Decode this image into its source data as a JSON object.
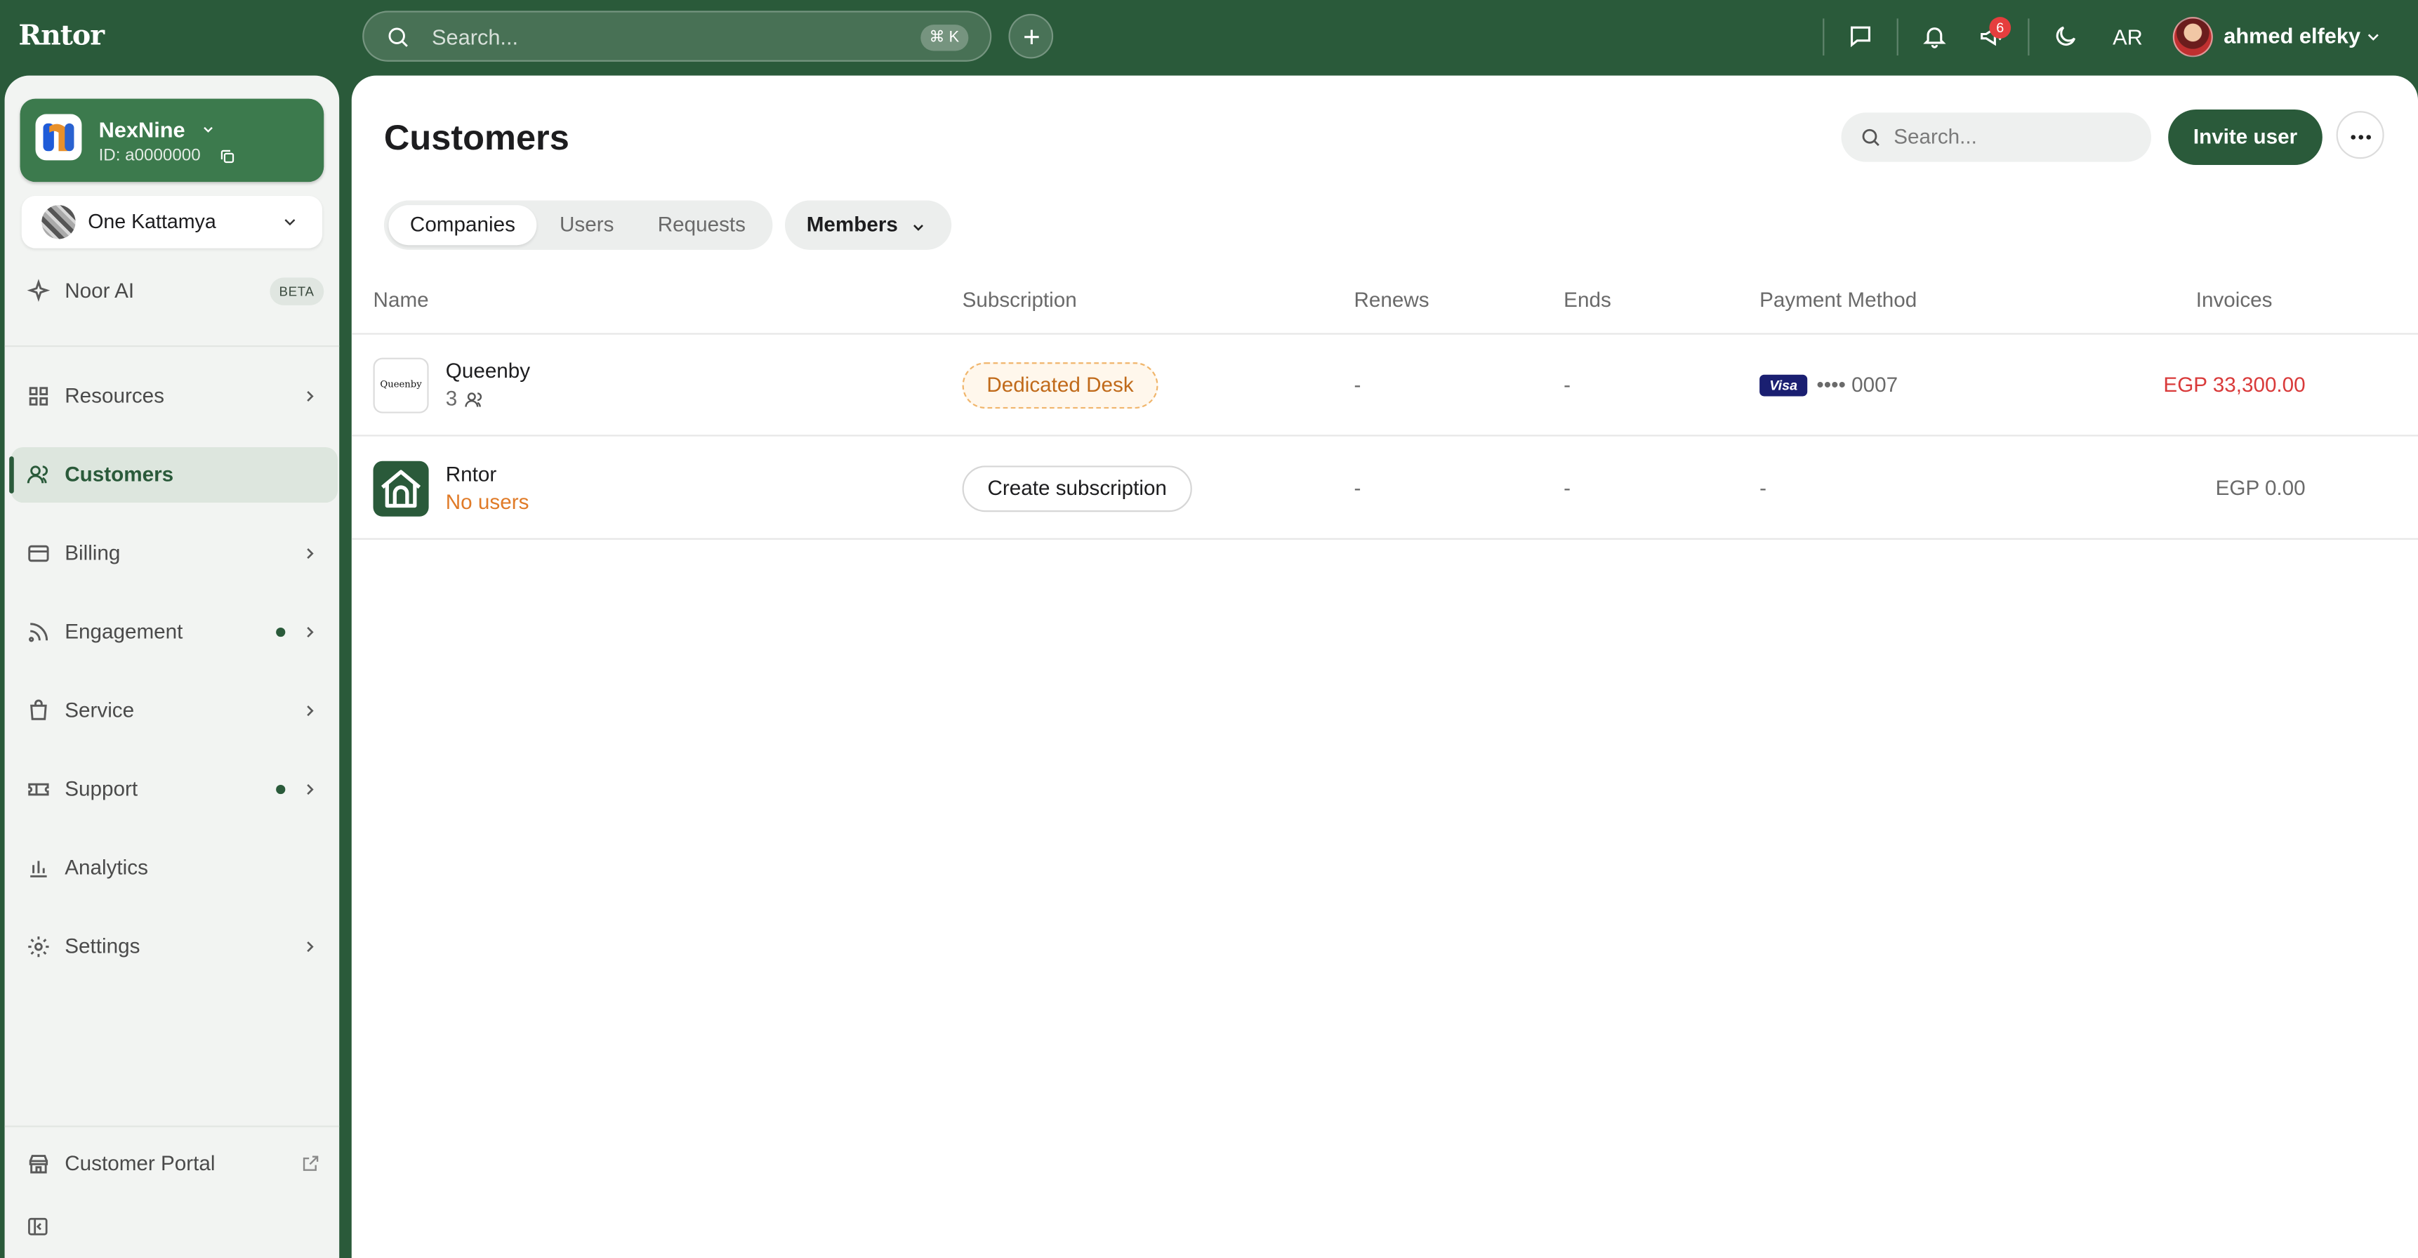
{
  "app": {
    "logo": "Rntor"
  },
  "topbar": {
    "search_placeholder": "Search...",
    "search_shortcut": "⌘ K",
    "notification_count": "6",
    "language": "AR",
    "user_name": "ahmed elfeky"
  },
  "sidebar": {
    "org": {
      "name": "NexNine",
      "id": "ID: a0000000"
    },
    "location": {
      "name": "One Kattamya"
    },
    "ai": {
      "label": "Noor AI",
      "badge": "BETA"
    },
    "items": [
      {
        "label": "Resources"
      },
      {
        "label": "Customers"
      },
      {
        "label": "Billing"
      },
      {
        "label": "Engagement"
      },
      {
        "label": "Service"
      },
      {
        "label": "Support"
      },
      {
        "label": "Analytics"
      },
      {
        "label": "Settings"
      }
    ],
    "portal": {
      "label": "Customer Portal"
    }
  },
  "main": {
    "title": "Customers",
    "search_placeholder": "Search...",
    "invite_label": "Invite user",
    "tabs": [
      {
        "label": "Companies"
      },
      {
        "label": "Users"
      },
      {
        "label": "Requests"
      }
    ],
    "members_label": "Members",
    "columns": {
      "name": "Name",
      "subscription": "Subscription",
      "renews": "Renews",
      "ends": "Ends",
      "payment": "Payment Method",
      "invoices": "Invoices"
    },
    "rows": [
      {
        "logo_text": "Queenby",
        "name": "Queenby",
        "users": "3",
        "subscription": "Dedicated Desk",
        "renews": "-",
        "ends": "-",
        "card_brand": "Visa",
        "card_mask": "•••• 0007",
        "invoices": "EGP 33,300.00"
      },
      {
        "name": "Rntor",
        "users": "No users",
        "subscription": "Create subscription",
        "renews": "-",
        "ends": "-",
        "payment": "-",
        "invoices": "EGP 0.00"
      }
    ]
  },
  "colors": {
    "brand": "#2a5a3a",
    "warning": "#c06a1a",
    "danger": "#d93a3a",
    "orange_text": "#e07b28"
  }
}
